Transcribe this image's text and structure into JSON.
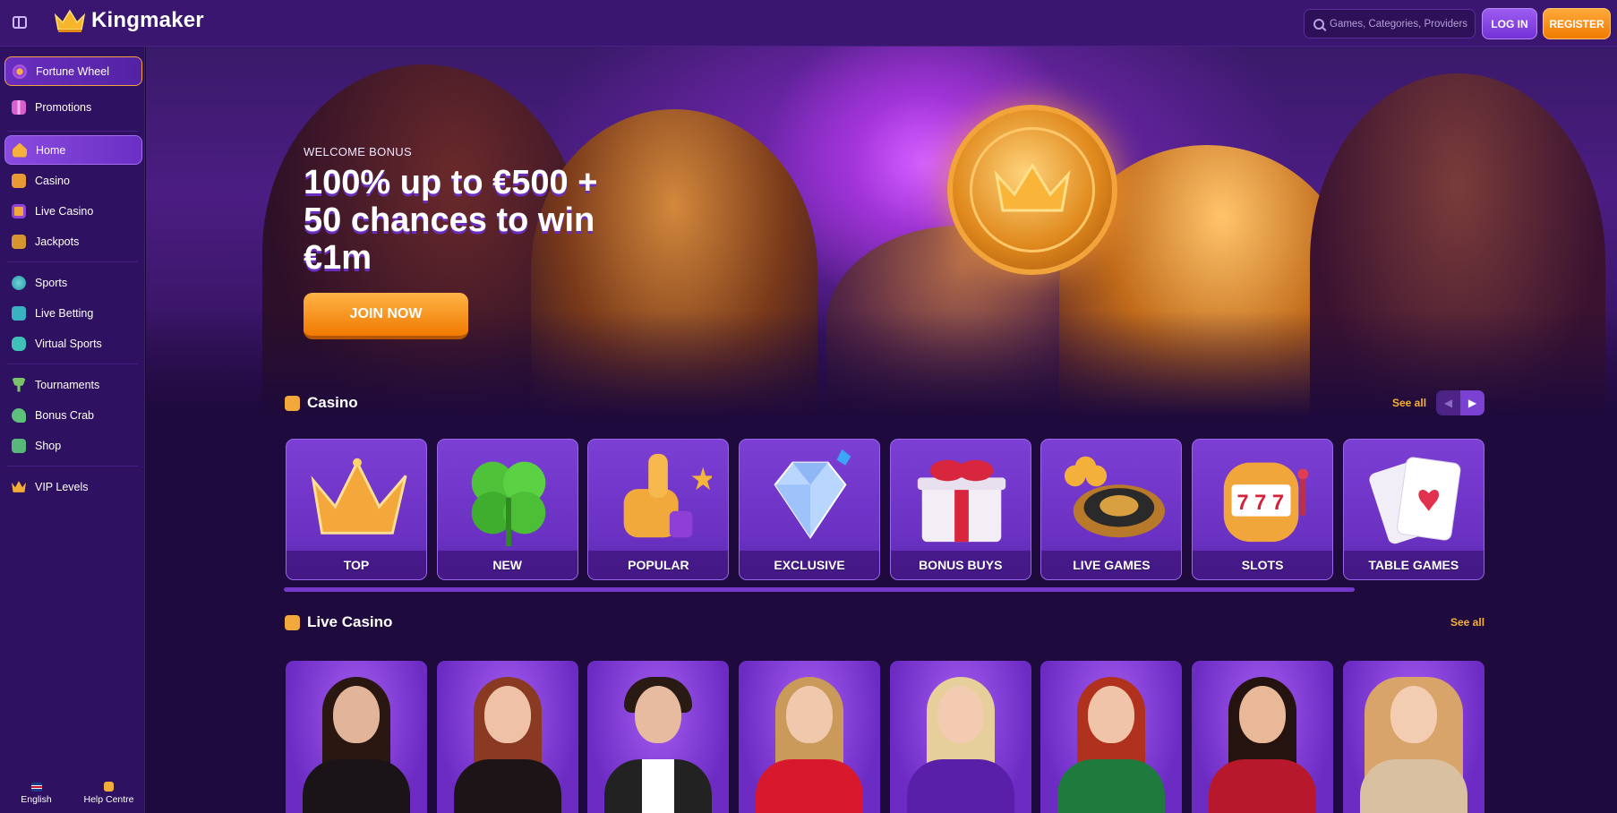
{
  "header": {
    "brand": "Kingmaker",
    "search_placeholder": "Games, Categories, Providers",
    "login_label": "LOG IN",
    "register_label": "REGISTER"
  },
  "sidebar": {
    "items": [
      {
        "label": "Fortune Wheel",
        "icon": "fortune-wheel-icon"
      },
      {
        "label": "Promotions",
        "icon": "gift-icon"
      },
      {
        "label": "Home",
        "icon": "home-icon"
      },
      {
        "label": "Casino",
        "icon": "slot-machine-icon"
      },
      {
        "label": "Live Casino",
        "icon": "live-casino-icon"
      },
      {
        "label": "Jackpots",
        "icon": "jackpot-icon"
      },
      {
        "label": "Sports",
        "icon": "ball-icon"
      },
      {
        "label": "Live Betting",
        "icon": "live-betting-icon"
      },
      {
        "label": "Virtual Sports",
        "icon": "gamepad-icon"
      },
      {
        "label": "Tournaments",
        "icon": "trophy-icon"
      },
      {
        "label": "Bonus Crab",
        "icon": "crab-icon"
      },
      {
        "label": "Shop",
        "icon": "shop-bag-icon"
      },
      {
        "label": "VIP Levels",
        "icon": "crown-icon"
      }
    ],
    "footer": {
      "language": "English",
      "help": "Help Centre"
    }
  },
  "hero": {
    "eyebrow": "WELCOME BONUS",
    "title": "100% up to €500 + 50 chances to win €1m",
    "cta": "JOIN NOW"
  },
  "casino": {
    "title": "Casino",
    "see_all": "See all",
    "categories": [
      "TOP",
      "NEW",
      "POPULAR",
      "EXCLUSIVE",
      "BONUS BUYS",
      "LIVE GAMES",
      "SLOTS",
      "TABLE GAMES"
    ]
  },
  "live_casino": {
    "title": "Live Casino",
    "see_all": "See all"
  },
  "colors": {
    "accent_orange": "#f58a0f",
    "accent_purple": "#7a41d3",
    "sidebar_bg": "#2e1160",
    "page_bg": "#1e0a3c"
  }
}
